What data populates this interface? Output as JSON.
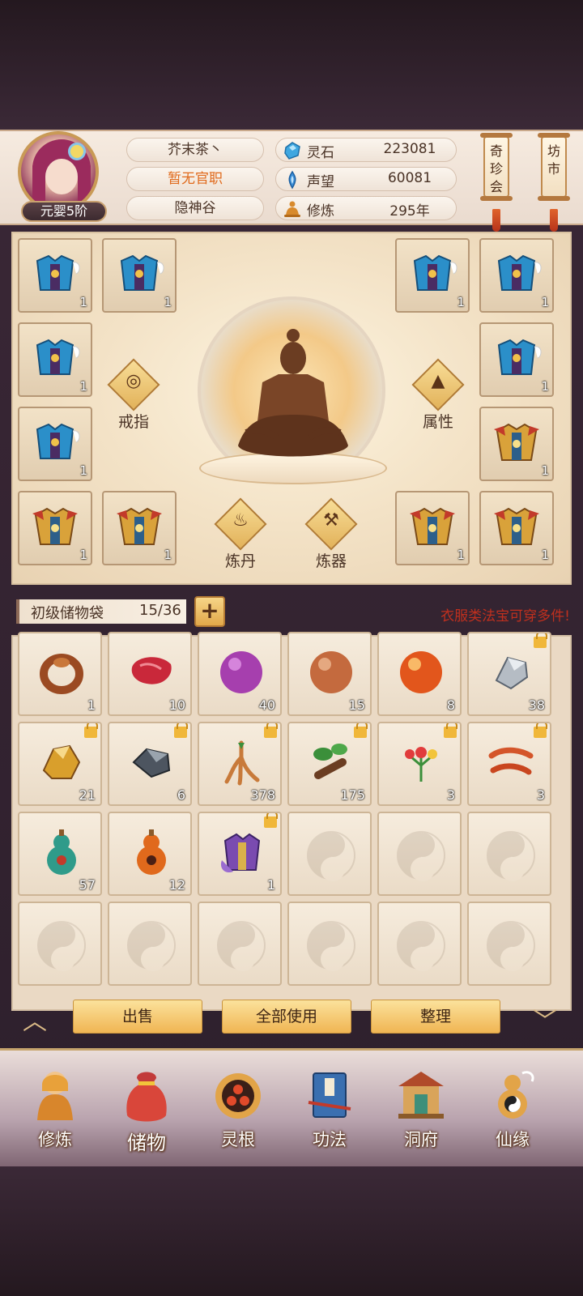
{
  "player": {
    "name": "芥末茶丶",
    "official_post": "暂无官职",
    "sect": "隐神谷",
    "realm": "元婴5阶"
  },
  "resources": [
    {
      "icon": "spirit-stone-icon",
      "label": "灵石",
      "value": "223081"
    },
    {
      "icon": "prestige-icon",
      "label": "声望",
      "value": "60081"
    },
    {
      "icon": "cultivation-icon",
      "label": "修炼",
      "value": "295年"
    }
  ],
  "side_buttons": {
    "treasure_fair": "奇珍会",
    "market": "坊市"
  },
  "equipment": {
    "left_slots": [
      {
        "item": "blue-armor",
        "count": "1"
      },
      {
        "item": "blue-armor",
        "count": "1"
      },
      {
        "item": "blue-armor",
        "count": "1"
      },
      {
        "item": "blue-armor",
        "count": "1"
      },
      {
        "item": "gold-armor",
        "count": "1"
      },
      {
        "item": "gold-armor",
        "count": "1"
      }
    ],
    "right_slots": [
      {
        "item": "blue-armor",
        "count": "1"
      },
      {
        "item": "blue-armor",
        "count": "1"
      },
      {
        "item": "blue-armor",
        "count": "1"
      },
      {
        "item": "gold-armor",
        "count": "1"
      },
      {
        "item": "gold-armor",
        "count": "1"
      },
      {
        "item": "gold-armor",
        "count": "1"
      }
    ],
    "ring_label": "戒指",
    "attributes_label": "属性",
    "alchemy_label": "炼丹",
    "forging_label": "炼器"
  },
  "bag": {
    "name": "初级储物袋",
    "capacity": "15/36",
    "add_label": "+",
    "hint": "衣服类法宝可穿多件!"
  },
  "inventory": [
    {
      "item": "ring",
      "count": "1",
      "locked": false
    },
    {
      "item": "raw-meat",
      "count": "10",
      "locked": false
    },
    {
      "item": "purple-orb",
      "count": "40",
      "locked": false
    },
    {
      "item": "bronze-orb",
      "count": "15",
      "locked": false
    },
    {
      "item": "orange-orb",
      "count": "8",
      "locked": false
    },
    {
      "item": "silver-ore",
      "count": "38",
      "locked": true
    },
    {
      "item": "gold-ore",
      "count": "21",
      "locked": true
    },
    {
      "item": "iron-ore",
      "count": "6",
      "locked": true
    },
    {
      "item": "ginseng",
      "count": "378",
      "locked": true
    },
    {
      "item": "herb-root",
      "count": "175",
      "locked": true
    },
    {
      "item": "flower-herb",
      "count": "3",
      "locked": true
    },
    {
      "item": "cordyceps",
      "count": "3",
      "locked": true
    },
    {
      "item": "green-gourd",
      "count": "57",
      "locked": false
    },
    {
      "item": "orange-gourd",
      "count": "12",
      "locked": false
    },
    {
      "item": "purple-armor",
      "count": "1",
      "locked": true
    }
  ],
  "actions": {
    "sell": "出售",
    "use_all": "全部使用",
    "sort": "整理"
  },
  "nav": [
    {
      "label": "修炼",
      "icon": "monk-icon"
    },
    {
      "label": "储物",
      "icon": "pouch-icon"
    },
    {
      "label": "灵根",
      "icon": "spirit-root-icon"
    },
    {
      "label": "功法",
      "icon": "scripture-icon"
    },
    {
      "label": "洞府",
      "icon": "cave-mansion-icon"
    },
    {
      "label": "仙缘",
      "icon": "gourd-icon"
    }
  ],
  "colors": {
    "accent": "#e06a1c",
    "hint_red": "#c0301e",
    "button_gold": "#f0b553"
  }
}
